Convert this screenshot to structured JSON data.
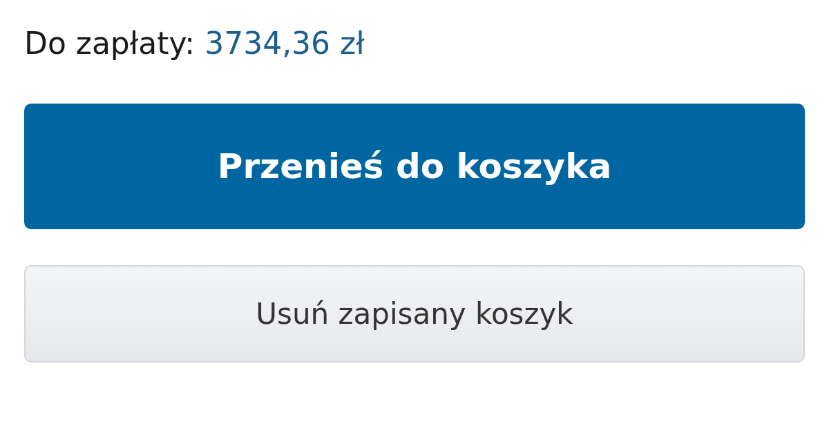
{
  "total": {
    "label": "Do zapłaty:",
    "amount": "3734,36 zł"
  },
  "buttons": [
    {
      "kind": "primary",
      "label": "Przenieś do koszyka"
    },
    {
      "kind": "secondary",
      "label": "Usuń zapisany koszyk"
    }
  ]
}
